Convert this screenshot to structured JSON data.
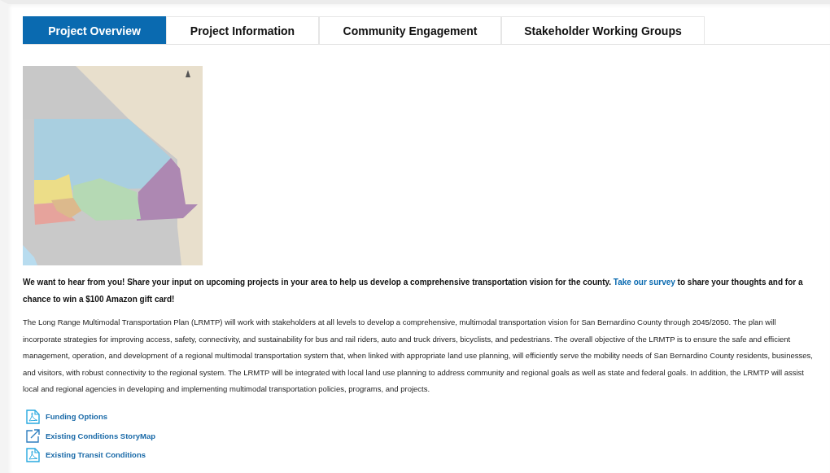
{
  "tabs": [
    {
      "label": "Project Overview",
      "selected": true
    },
    {
      "label": "Project Information",
      "selected": false
    },
    {
      "label": "Community Engagement",
      "selected": false
    },
    {
      "label": "Stakeholder Working Groups",
      "selected": false
    }
  ],
  "announcement": {
    "before": "We want to hear from you! Share your input on upcoming projects in your area to help us develop a comprehensive transportation vision for the county. ",
    "link": "Take our survey",
    "after": " to share your thoughts and for a chance to win a $100 Amazon gift card!"
  },
  "description": "The Long Range Multimodal Transportation Plan (LRMTP) will work with stakeholders at all levels to develop a comprehensive, multimodal transportation vision for San Bernardino County through 2045/2050. The plan will incorporate strategies for improving access, safety, connectivity, and sustainability for bus and rail riders, auto and truck drivers, bicyclists, and pedestrians. The overall objective of the LRMTP is to ensure the safe and efficient management, operation, and development of a regional multimodal transportation system that, when linked with appropriate land use planning, will efficiently serve the mobility needs of San Bernardino County residents, businesses, and visitors, with robust connectivity to the regional system. The LRMTP will be integrated with local land use planning to address community and regional goals as well as state and federal goals. In addition, the LRMTP will assist local and regional agencies in developing and implementing multimodal transportation policies, programs, and projects.",
  "links": [
    {
      "kind": "pdf",
      "label": "Funding Options"
    },
    {
      "kind": "external",
      "label": "Existing Conditions StoryMap"
    },
    {
      "kind": "pdf",
      "label": "Existing Transit Conditions"
    }
  ]
}
